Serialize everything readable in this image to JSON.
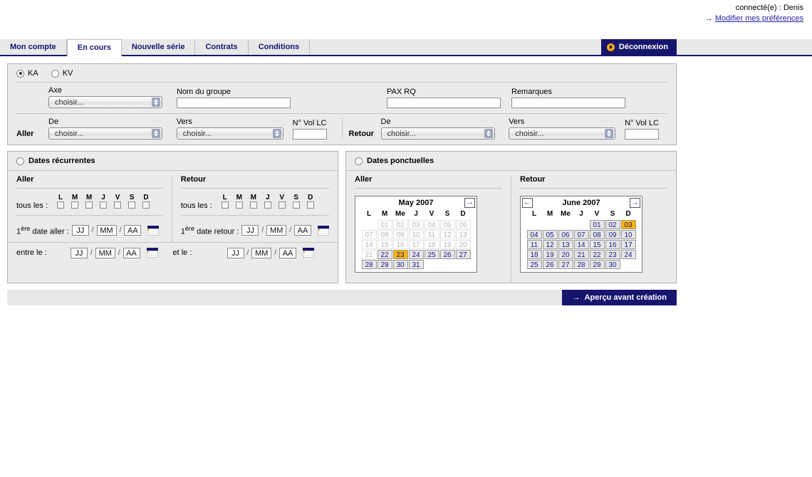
{
  "header": {
    "connected_label": "connecté(e) : Denis",
    "preferences_arrow": "→",
    "preferences_link": "Modifier mes préférences"
  },
  "tabs": [
    {
      "label": "Mon compte",
      "active": false
    },
    {
      "label": "En cours",
      "active": true
    },
    {
      "label": "Nouvelle série",
      "active": false
    },
    {
      "label": "Contrats",
      "active": false
    },
    {
      "label": "Conditions",
      "active": false
    }
  ],
  "logout": {
    "label": "Déconnexion",
    "icon": "play-circle-icon"
  },
  "form": {
    "type_radios": [
      {
        "label": "KA",
        "checked": true
      },
      {
        "label": "KV",
        "checked": false
      }
    ],
    "axe": {
      "label": "Axe",
      "value": "choisir..."
    },
    "nom_du_groupe": {
      "label": "Nom du groupe",
      "value": ""
    },
    "pax_rq": {
      "label": "PAX RQ",
      "value": ""
    },
    "remarques": {
      "label": "Remarques",
      "value": ""
    },
    "aller": {
      "leg_label": "Aller",
      "de": {
        "label": "De",
        "value": "choisir..."
      },
      "vers": {
        "label": "Vers",
        "value": "choisir..."
      },
      "vol": {
        "label": "N° Vol LC",
        "value": ""
      }
    },
    "retour": {
      "leg_label": "Retour",
      "de": {
        "label": "De",
        "value": "choisir..."
      },
      "vers": {
        "label": "Vers",
        "value": "choisir..."
      },
      "vol": {
        "label": "N° Vol LC",
        "value": ""
      }
    }
  },
  "recurrentes": {
    "title": "Dates récurrentes",
    "checked": false,
    "aller": {
      "title": "Aller",
      "every_label": "tous les :",
      "weekdays": [
        "L",
        "M",
        "M",
        "J",
        "V",
        "S",
        "D"
      ],
      "first_date_label": "1ère date aller :",
      "dd": "JJ",
      "mm": "MM",
      "yy": "AA",
      "calendar_icon": "calendar-icon"
    },
    "retour": {
      "title": "Retour",
      "every_label": "tous les :",
      "weekdays": [
        "L",
        "M",
        "M",
        "J",
        "V",
        "S",
        "D"
      ],
      "first_date_label": "1ère date retour :",
      "dd": "JJ",
      "mm": "MM",
      "yy": "AA",
      "calendar_icon": "calendar-icon"
    },
    "between": {
      "from_label": "entre le :",
      "to_label": "et le :",
      "dd": "JJ",
      "mm": "MM",
      "yy": "AA"
    },
    "separator": "/"
  },
  "ponctuelles": {
    "title": "Dates ponctuelles",
    "checked": false,
    "aller_title": "Aller",
    "retour_title": "Retour"
  },
  "calendars": [
    {
      "name": "aller-calendar",
      "title": "May 2007",
      "prev_enabled": false,
      "next_enabled": true,
      "prev_icon": "←",
      "next_icon": "→",
      "weekday_headers": [
        "L",
        "M",
        "Me",
        "J",
        "V",
        "S",
        "D"
      ],
      "lead_blanks": 1,
      "days": [
        {
          "d": "01",
          "state": "off"
        },
        {
          "d": "02",
          "state": "off"
        },
        {
          "d": "03",
          "state": "off"
        },
        {
          "d": "04",
          "state": "off"
        },
        {
          "d": "05",
          "state": "off"
        },
        {
          "d": "06",
          "state": "off"
        },
        {
          "d": "07",
          "state": "off"
        },
        {
          "d": "08",
          "state": "off"
        },
        {
          "d": "09",
          "state": "off"
        },
        {
          "d": "10",
          "state": "off"
        },
        {
          "d": "11",
          "state": "off"
        },
        {
          "d": "12",
          "state": "off"
        },
        {
          "d": "13",
          "state": "off"
        },
        {
          "d": "14",
          "state": "off"
        },
        {
          "d": "15",
          "state": "off"
        },
        {
          "d": "16",
          "state": "off"
        },
        {
          "d": "17",
          "state": "off"
        },
        {
          "d": "18",
          "state": "off"
        },
        {
          "d": "19",
          "state": "off"
        },
        {
          "d": "20",
          "state": "off"
        },
        {
          "d": "21",
          "state": "off"
        },
        {
          "d": "22",
          "state": "on"
        },
        {
          "d": "23",
          "state": "sel"
        },
        {
          "d": "24",
          "state": "on"
        },
        {
          "d": "25",
          "state": "on"
        },
        {
          "d": "26",
          "state": "on"
        },
        {
          "d": "27",
          "state": "on"
        },
        {
          "d": "28",
          "state": "on"
        },
        {
          "d": "29",
          "state": "on"
        },
        {
          "d": "30",
          "state": "on"
        },
        {
          "d": "31",
          "state": "on"
        }
      ]
    },
    {
      "name": "retour-calendar",
      "title": "June 2007",
      "prev_enabled": true,
      "next_enabled": true,
      "prev_icon": "←",
      "next_icon": "→",
      "weekday_headers": [
        "L",
        "M",
        "Me",
        "J",
        "V",
        "S",
        "D"
      ],
      "lead_blanks": 4,
      "days": [
        {
          "d": "01",
          "state": "on"
        },
        {
          "d": "02",
          "state": "on"
        },
        {
          "d": "03",
          "state": "sel"
        },
        {
          "d": "04",
          "state": "on"
        },
        {
          "d": "05",
          "state": "on"
        },
        {
          "d": "06",
          "state": "on"
        },
        {
          "d": "07",
          "state": "on"
        },
        {
          "d": "08",
          "state": "on"
        },
        {
          "d": "09",
          "state": "on"
        },
        {
          "d": "10",
          "state": "on"
        },
        {
          "d": "11",
          "state": "on"
        },
        {
          "d": "12",
          "state": "on"
        },
        {
          "d": "13",
          "state": "on"
        },
        {
          "d": "14",
          "state": "on"
        },
        {
          "d": "15",
          "state": "on"
        },
        {
          "d": "16",
          "state": "on"
        },
        {
          "d": "17",
          "state": "on"
        },
        {
          "d": "18",
          "state": "on"
        },
        {
          "d": "19",
          "state": "on"
        },
        {
          "d": "20",
          "state": "on"
        },
        {
          "d": "21",
          "state": "on"
        },
        {
          "d": "22",
          "state": "on"
        },
        {
          "d": "23",
          "state": "on"
        },
        {
          "d": "24",
          "state": "on"
        },
        {
          "d": "25",
          "state": "on"
        },
        {
          "d": "26",
          "state": "on"
        },
        {
          "d": "27",
          "state": "on"
        },
        {
          "d": "28",
          "state": "on"
        },
        {
          "d": "29",
          "state": "on"
        },
        {
          "d": "30",
          "state": "on"
        }
      ]
    }
  ],
  "footer": {
    "submit_arrow": "→",
    "submit_label": "Aperçu avant création"
  },
  "colors": {
    "navy": "#16166e",
    "orange": "#ffb400",
    "link": "#2222aa",
    "panel_bg": "#ebebeb"
  }
}
